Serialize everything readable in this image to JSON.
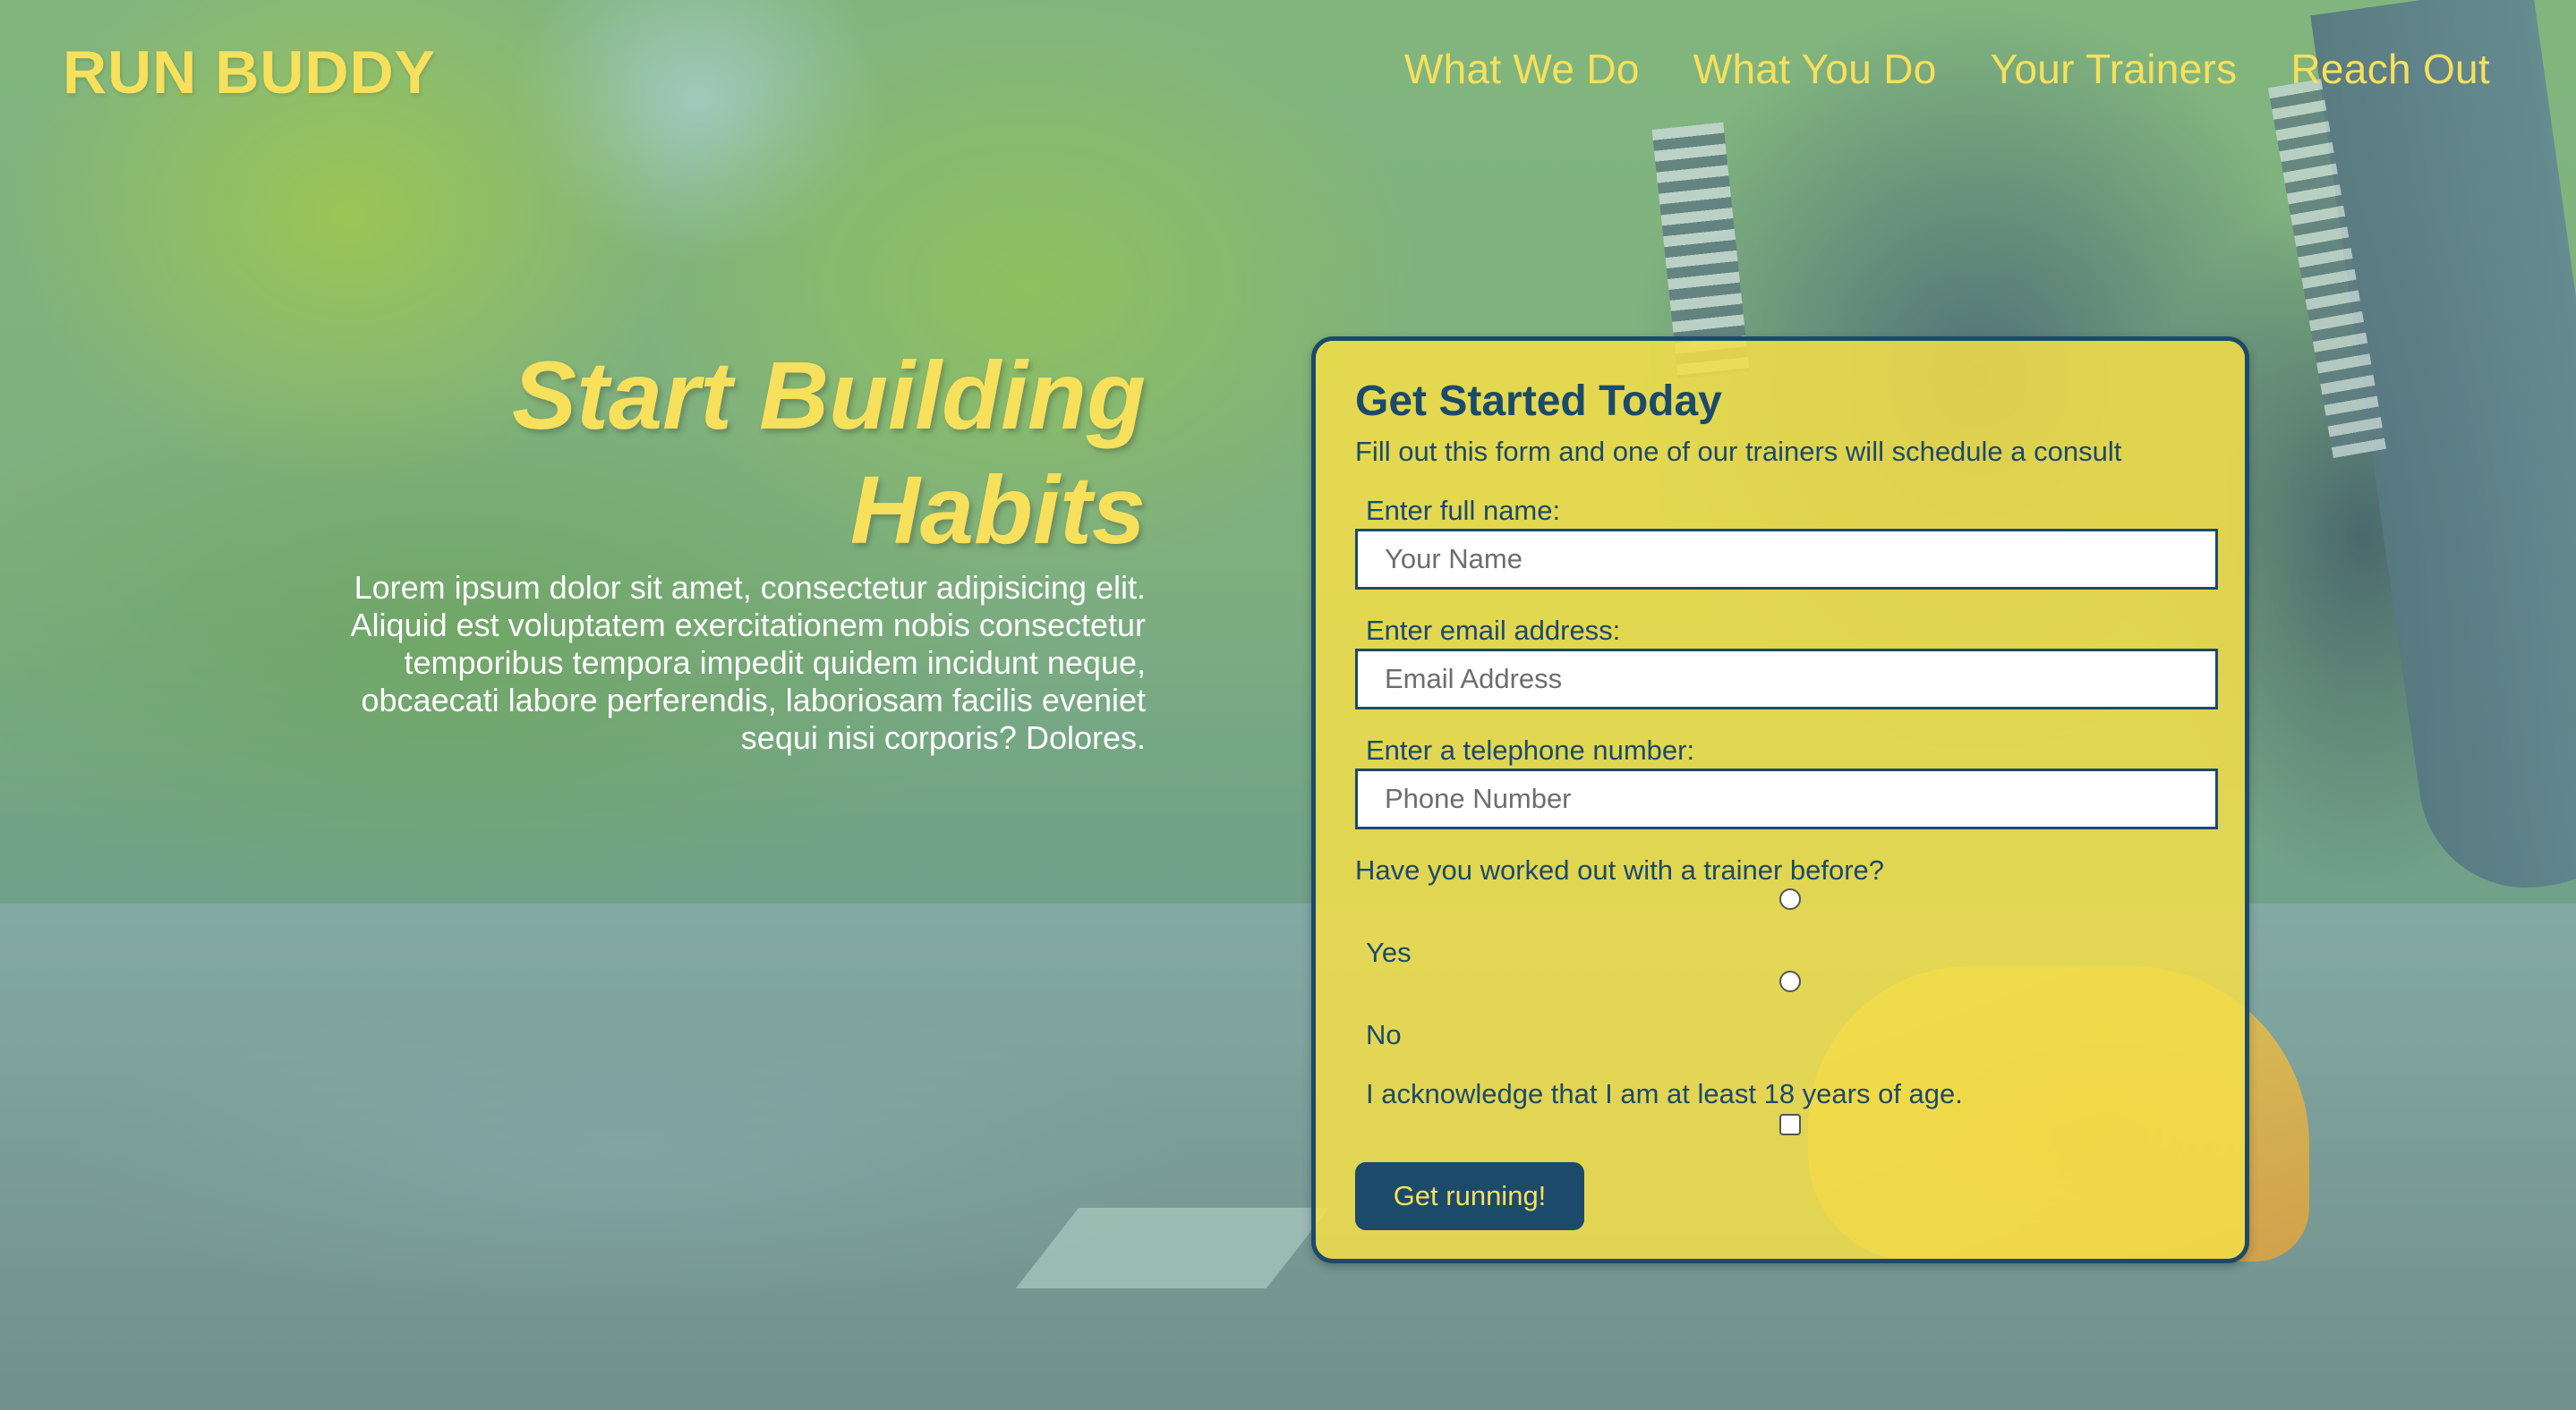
{
  "brand": {
    "logo_text": "RUN BUDDY"
  },
  "nav": {
    "items": [
      "What We Do",
      "What You Do",
      "Your Trainers",
      "Reach Out"
    ]
  },
  "hero": {
    "title_line1": "Start Building",
    "title_line2": "Habits",
    "body": "Lorem ipsum dolor sit amet, consectetur adipisicing elit. Aliquid est voluptatem exercitationem nobis consectetur temporibus tempora impedit quidem incidunt neque, obcaecati labore perferendis, laboriosam facilis eveniet sequi nisi corporis? Dolores."
  },
  "form": {
    "title": "Get Started Today",
    "subtitle": "Fill out this form and one of our trainers will schedule a consult",
    "name_label": "Enter full name:",
    "name_placeholder": "Your Name",
    "email_label": "Enter email address:",
    "email_placeholder": "Email Address",
    "phone_label": "Enter a telephone number:",
    "phone_placeholder": "Phone Number",
    "trainer_question": "Have you worked out with a trainer before?",
    "option_yes": "Yes",
    "option_no": "No",
    "age_ack": "I acknowledge that I am at least 18 years of age.",
    "submit_label": "Get running!"
  },
  "colors": {
    "accent_yellow": "#f7e05c",
    "navy": "#1b4a6b",
    "card_yellow": "#f3de48"
  }
}
